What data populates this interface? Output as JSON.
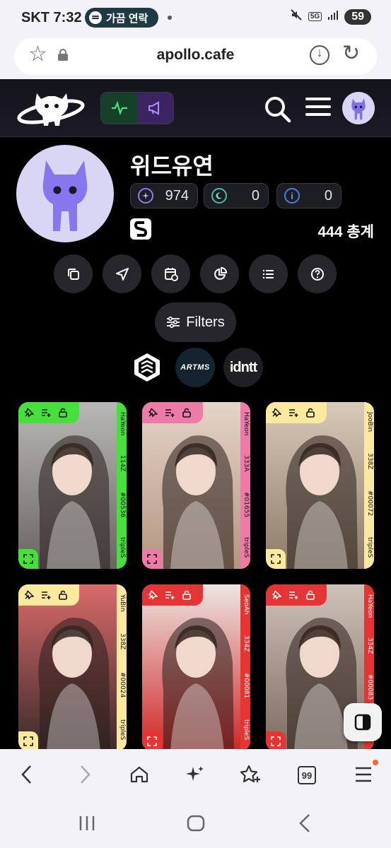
{
  "status_bar": {
    "carrier_time": "SKT 7:32",
    "media_label": "가끔 연락",
    "network": "5G",
    "battery": "59"
  },
  "browser": {
    "url": "apollo.cafe",
    "tab_count": "99"
  },
  "profile": {
    "name": "위드유연",
    "stats": [
      {
        "icon": "cosmo-icon",
        "value": "974",
        "color": "#8b7ff0"
      },
      {
        "icon": "moon-icon",
        "value": "0",
        "color": "#4fb7a8"
      },
      {
        "icon": "info-icon",
        "value": "0",
        "color": "#4a7fe0"
      }
    ],
    "total": "444 총계"
  },
  "actions": [
    "copy-icon",
    "send-icon",
    "calendar-icon",
    "pie-chart-icon",
    "list-icon",
    "help-icon"
  ],
  "filters_label": "Filters",
  "brands": {
    "artms": "ARTMS",
    "idntt": "idntt"
  },
  "cards": [
    {
      "member": "HaYeon",
      "season": "114Z",
      "number": "#00536",
      "group": "tripleS",
      "color": "#45e03a",
      "photo_bg": [
        "#b9b8b6",
        "#6a6461"
      ]
    },
    {
      "member": "HaYeon",
      "season": "333A",
      "number": "#01655",
      "group": "tripleS",
      "color": "#ee7aa8",
      "photo_bg": [
        "#e6d4c9",
        "#b29580"
      ]
    },
    {
      "member": "JooBin",
      "season": "338Z",
      "number": "#00072",
      "group": "tripleS",
      "color": "#fbe9a0",
      "photo_bg": [
        "#d9c9b8",
        "#8d7a69"
      ]
    },
    {
      "member": "YuBin",
      "season": "338Z",
      "number": "#00024",
      "group": "tripleS",
      "color": "#fbe9a0",
      "photo_bg": [
        "#d96a6a",
        "#3a2a2a"
      ]
    },
    {
      "member": "SeoAh",
      "season": "334Z",
      "number": "#00081",
      "group": "tripleS",
      "color": "#e63434",
      "photo_bg": [
        "#ece6e2",
        "#d02626"
      ]
    },
    {
      "member": "HaYeon",
      "season": "334Z",
      "number": "#00083",
      "group": "tripleS",
      "color": "#e63434",
      "photo_bg": [
        "#cfc2b9",
        "#7c6b60"
      ]
    }
  ]
}
